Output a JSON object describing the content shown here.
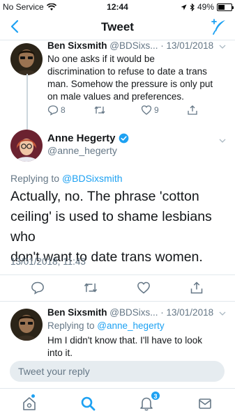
{
  "status_bar": {
    "carrier": "No Service",
    "time": "12:44",
    "battery": "49%",
    "battery_level": 0.49
  },
  "nav": {
    "title": "Tweet"
  },
  "context_tweet": {
    "name": "Ben Sixsmith",
    "handle": "@BDSixs...",
    "date": "· 13/01/2018",
    "lines": [
      "No one asks if it would be",
      "discrimination to refuse to date a trans",
      "man. Somehow the pressure is only put",
      "on male values and preferences."
    ],
    "reply_count": "8",
    "like_count": "9"
  },
  "main_tweet": {
    "name": "Anne Hegerty",
    "handle": "@anne_hegerty",
    "replying_prefix": "Replying to ",
    "replying_to": "@BDSixsmith",
    "lines": [
      "Actually, no.  The phrase 'cotton",
      "ceiling' is used to shame lesbians who",
      "don't want to date trans women."
    ],
    "timestamp": "13/01/2018, 11:43"
  },
  "reply_tweet": {
    "name": "Ben Sixsmith",
    "handle": "@BDSixs...",
    "date": "· 13/01/2018",
    "replying_prefix": "Replying to ",
    "replying_to": "@anne_hegerty",
    "lines": [
      "Hm I didn't know that. I'll have to look",
      "into it."
    ]
  },
  "composer": {
    "placeholder": "Tweet your reply"
  },
  "tab_bar": {
    "notifications_badge": "3"
  },
  "colors": {
    "accent": "#1da1f2",
    "verified": "#1da1f2",
    "secondary_text": "#657786"
  },
  "icons": {
    "nav_back": "chevron-left-icon",
    "nav_compose": "compose-feather-icon",
    "reply": "reply-bubble-icon",
    "retweet": "retweet-icon",
    "like": "heart-icon",
    "share": "share-icon",
    "verified": "verified-badge-icon",
    "tabs": [
      "home-icon",
      "search-icon",
      "bell-icon",
      "mail-icon"
    ]
  }
}
